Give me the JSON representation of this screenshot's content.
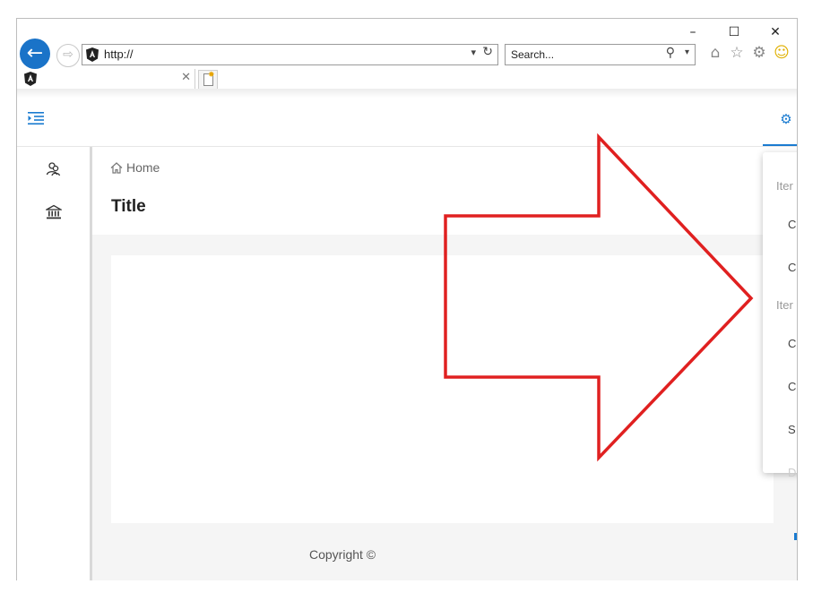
{
  "window": {
    "minimize": "–",
    "maximize": "☐",
    "close": "✕"
  },
  "browser": {
    "address_value": "http://",
    "search_placeholder": "Search...",
    "tab_title": "",
    "icons": [
      "back-arrow-icon",
      "forward-arrow-icon",
      "angular-logo-icon",
      "refresh-icon",
      "search-icon",
      "home-icon",
      "star-icon",
      "gear-icon",
      "smiley-icon",
      "new-tab-icon"
    ]
  },
  "app": {
    "breadcrumb": "Home",
    "title": "Title",
    "footer": "Copyright ©",
    "accent": "#1a7bd0"
  },
  "settings_menu": {
    "groups": [
      {
        "label": "Iter",
        "items": [
          "C",
          "C"
        ]
      },
      {
        "label": "Iter",
        "items": [
          "C",
          "C",
          "S"
        ]
      }
    ],
    "disabled_item": "D"
  },
  "annotation": {
    "arrow_color": "#e02020"
  }
}
